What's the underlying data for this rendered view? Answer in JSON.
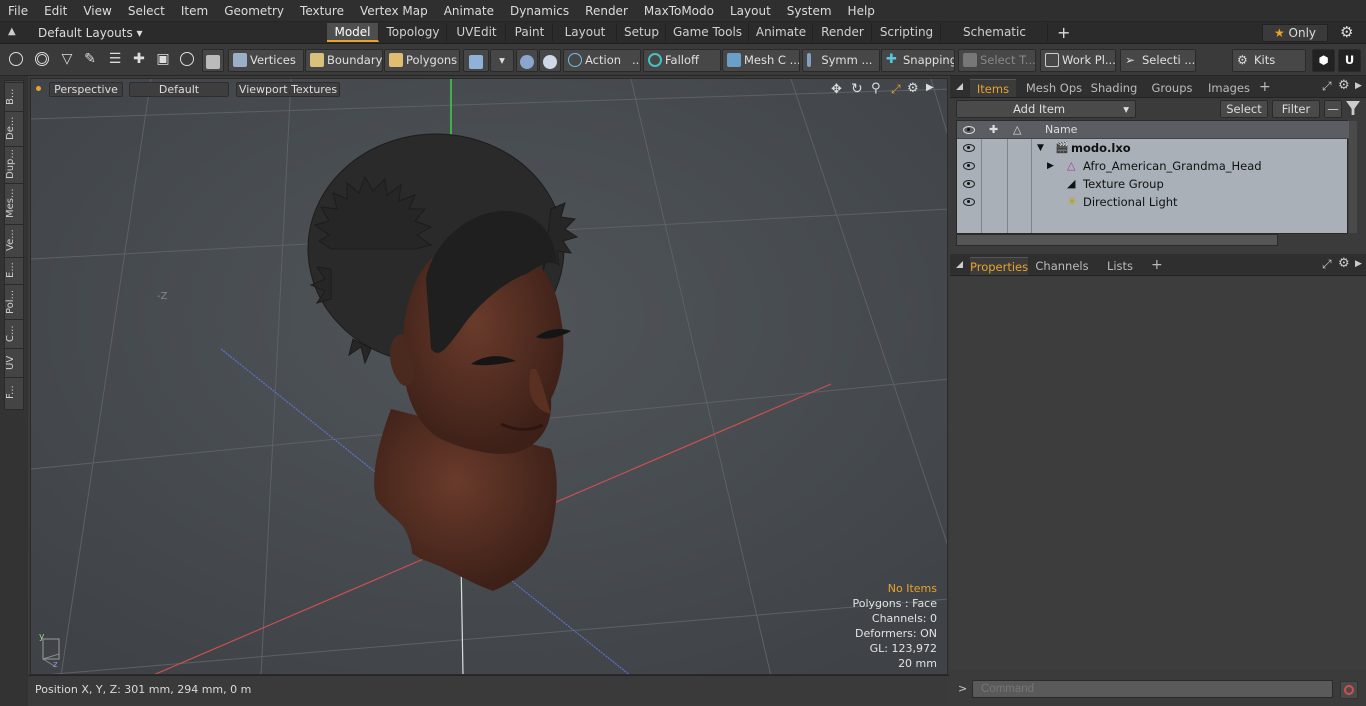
{
  "menu": [
    "File",
    "Edit",
    "View",
    "Select",
    "Item",
    "Geometry",
    "Texture",
    "Vertex Map",
    "Animate",
    "Dynamics",
    "Render",
    "MaxToModo",
    "Layout",
    "System",
    "Help"
  ],
  "layout_selector": "Default Layouts",
  "layout_tabs": [
    "Model",
    "Topology",
    "UVEdit",
    "Paint",
    "Layout",
    "Setup",
    "Game Tools",
    "Animate",
    "Render",
    "Scripting",
    "Schematic Fusion"
  ],
  "active_layout_tab": "Model",
  "only_label": "Only",
  "toolbar": {
    "vertices": "Vertices",
    "boundary": "Boundary",
    "polygons": "Polygons",
    "action": "Action",
    "action_more": "...",
    "falloff": "Falloff",
    "mesh": "Mesh C ...",
    "symm": "Symm ...",
    "snapping": "Snapping",
    "select_t": "Select T...",
    "work_pl": "Work Pl...",
    "selecti": "Selecti ...",
    "kits": "Kits"
  },
  "left_tabs": [
    "B...",
    "De...",
    "Dup...",
    "Mes...",
    "Ve...",
    "E...",
    "Pol...",
    "C...",
    "UV",
    "F..."
  ],
  "viewport": {
    "perspective": "Perspective",
    "default": "Default",
    "textures": "Viewport Textures",
    "axis_label": "-Z",
    "info": {
      "no_items": "No Items",
      "polygons": "Polygons : Face",
      "channels": "Channels: 0",
      "deformers": "Deformers: ON",
      "gl": "GL: 123,972",
      "scale": "20 mm"
    }
  },
  "status": "Position X, Y, Z:   301 mm, 294 mm, 0 m",
  "panel_tabs": [
    "Items",
    "Mesh Ops",
    "Shading",
    "Groups",
    "Images"
  ],
  "add_item": "Add Item",
  "select_btn": "Select",
  "filter_btn": "Filter",
  "items_header": "Name",
  "items": [
    {
      "name": "modo.lxo",
      "bold": true
    },
    {
      "name": "Afro_American_Grandma_Head",
      "bold": false
    },
    {
      "name": "Texture Group",
      "bold": false
    },
    {
      "name": "Directional Light",
      "bold": false
    }
  ],
  "props_tabs": [
    "Properties",
    "Channels",
    "Lists"
  ],
  "command_placeholder": "Command",
  "accent": "#e8a32a"
}
